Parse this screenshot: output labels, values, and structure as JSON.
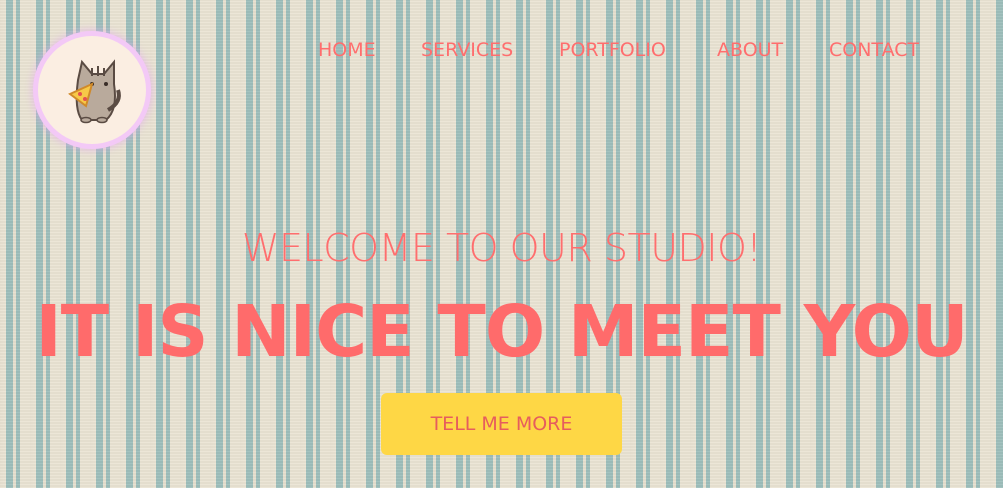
{
  "nav": {
    "items": [
      {
        "label": "HOME"
      },
      {
        "label": "SERVICES"
      },
      {
        "label": "PORTFOLIO"
      },
      {
        "label": "ABOUT"
      },
      {
        "label": "CONTACT"
      }
    ]
  },
  "hero": {
    "subtitle": "WELCOME TO OUR STUDIO!",
    "title": "IT IS NICE TO MEET YOU",
    "cta_label": "TELL ME MORE"
  },
  "logo": {
    "icon": "cat-eating-pizza-icon"
  },
  "colors": {
    "accent": "#ff6e6e",
    "button": "#fed745",
    "stripe": "#9fc0bd",
    "background": "#ece6d6"
  }
}
